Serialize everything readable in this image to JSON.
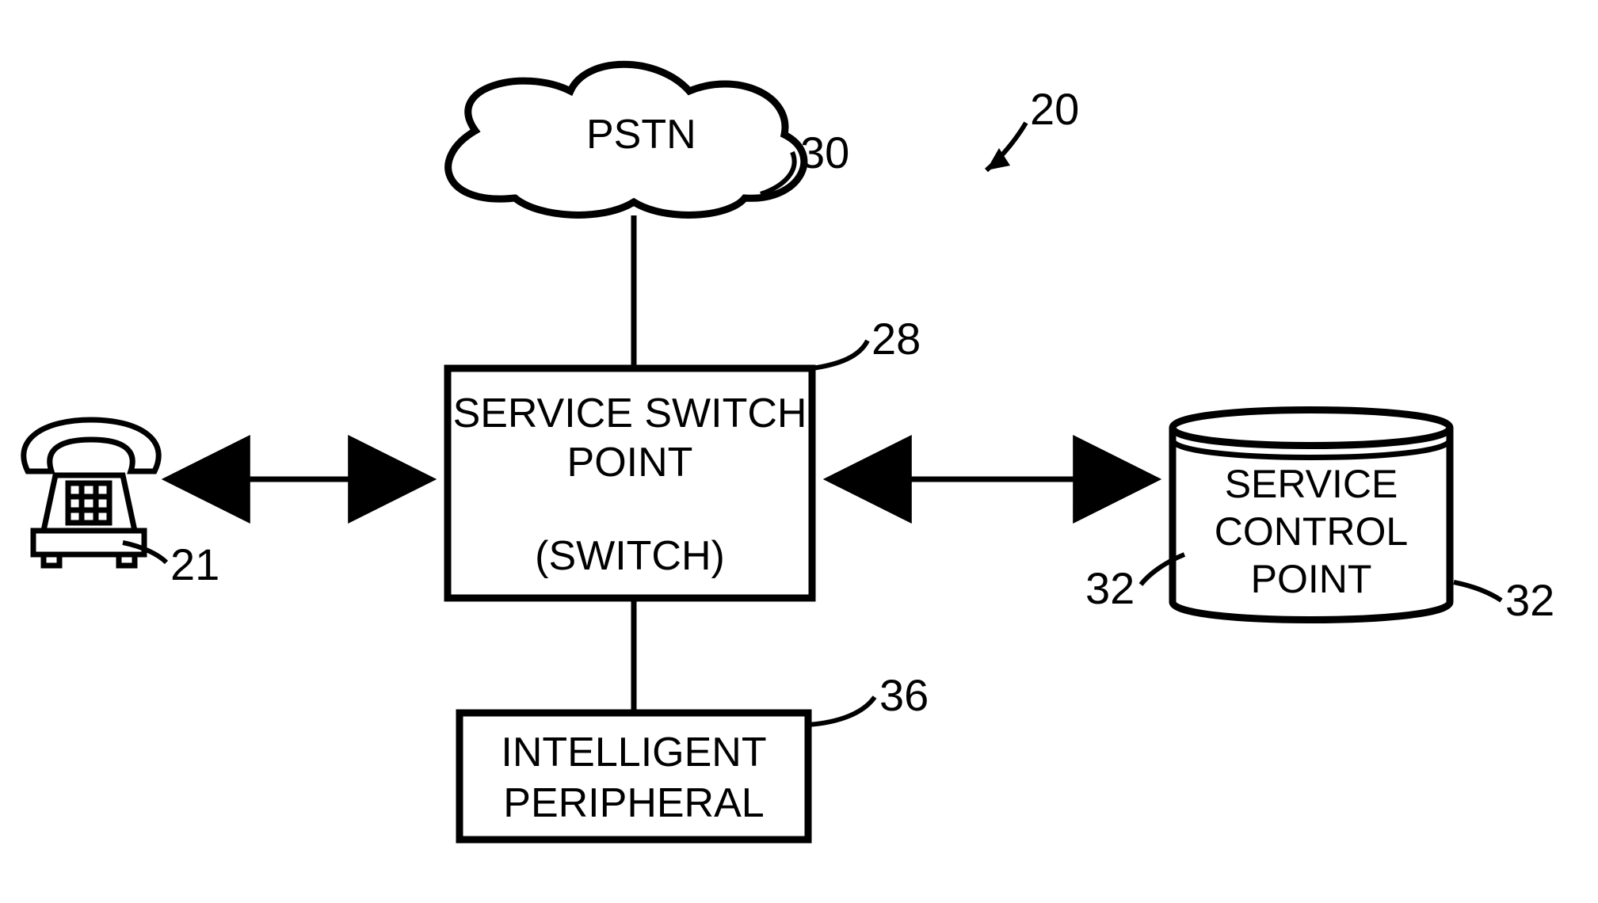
{
  "diagram": {
    "figure_ref": "20",
    "nodes": {
      "pstn": {
        "label": "PSTN",
        "ref": "30"
      },
      "ssp": {
        "label_line1": "SERVICE SWITCH",
        "label_line2": "POINT",
        "label_line3": "(SWITCH)",
        "ref": "28"
      },
      "scp": {
        "label_line1": "SERVICE",
        "label_line2": "CONTROL",
        "label_line3": "POINT",
        "ref_left": "32",
        "ref_right": "32"
      },
      "ip": {
        "label_line1": "INTELLIGENT",
        "label_line2": "PERIPHERAL",
        "ref": "36"
      },
      "phone": {
        "ref": "21"
      }
    }
  }
}
